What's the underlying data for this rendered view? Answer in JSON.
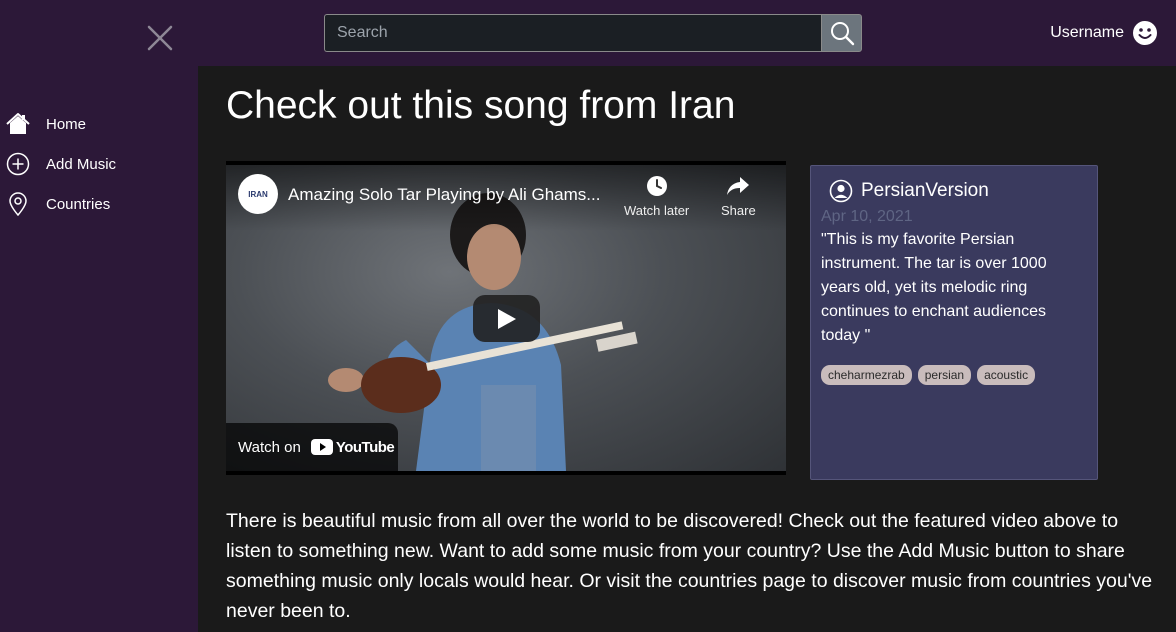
{
  "topbar": {
    "search_placeholder": "Search",
    "search_value": "",
    "username": "Username"
  },
  "sidebar": {
    "items": [
      {
        "label": "Home",
        "icon": "home-icon"
      },
      {
        "label": "Add Music",
        "icon": "plus-circle-icon"
      },
      {
        "label": "Countries",
        "icon": "location-pin-icon"
      }
    ]
  },
  "main": {
    "title": "Check out this song from Iran",
    "video": {
      "title": "Amazing Solo Tar Playing by Ali Ghams...",
      "channel_logo_text": "IRAN",
      "watch_later": "Watch later",
      "share": "Share",
      "watch_on": "Watch on",
      "youtube": "YouTube"
    },
    "post": {
      "username": "PersianVersion",
      "date": "Apr 10, 2021",
      "text": "\"This is my favorite Persian instrument. The tar is over 1000 years old, yet its melodic ring continues to enchant audiences today \"",
      "tags": [
        "cheharmezrab",
        "persian",
        "acoustic"
      ]
    },
    "description": "There is beautiful music from all over the world to be discovered! Check out the featured video above to listen to something new. Want to add some music from your country? Use the Add Music button to share something music only locals would hear. Or visit the countries page to discover music from countries you've never been to."
  },
  "colors": {
    "nav_bg": "#2c1838",
    "main_bg": "#1a1a1a",
    "card_bg": "#3a3a5e",
    "tag_bg": "#c9bcbc"
  }
}
